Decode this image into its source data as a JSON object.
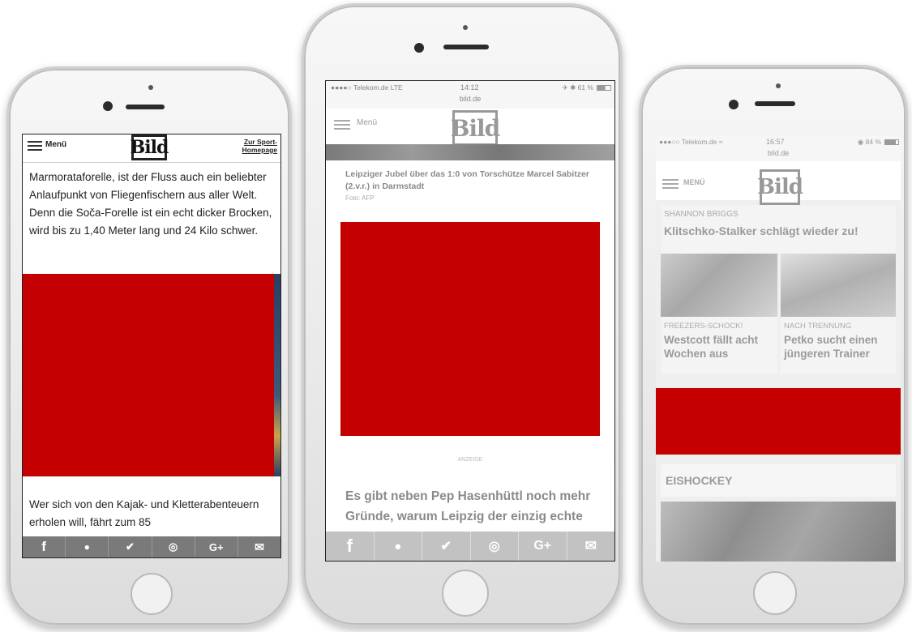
{
  "phone_left": {
    "header": {
      "menu_label": "Menü",
      "logo_text": "Bild",
      "sport_link": "Zur Sport-\nHomepage"
    },
    "article_top": "Marmorataforelle, ist der Fluss auch ein beliebter Anlaufpunkt von Fliegenfischern aus aller Welt. Denn die Soča-Forelle ist ein echt dicker Brocken, wird bis zu 1,40 Meter lang und 24 Kilo schwer.",
    "article_bottom": "Wer sich von den Kajak- und Kletterabenteuern erholen will, fährt zum 85",
    "share": [
      "f",
      "●",
      "✔",
      "◎",
      "G+",
      "✉"
    ]
  },
  "phone_center": {
    "status": {
      "carrier": "●●●●○ Telekom.de  LTE",
      "time": "14:12",
      "battery": "✈ ✱ 61 %",
      "url": "bild.de"
    },
    "header": {
      "menu_label": "Menü",
      "logo_text": "Bild"
    },
    "caption": "Leipziger Jubel über das 1:0 von Torschütze Marcel Sabitzer (2.v.r.) in Darmstadt",
    "credit": "Foto: AFP",
    "ad_label": "ANZEIGE",
    "headline": "Es gibt neben Pep Hasenhüttl noch mehr Gründe, warum Leipzig der einzig echte",
    "share": [
      "f",
      "●",
      "✔",
      "◎",
      "G+",
      "✉"
    ]
  },
  "phone_right": {
    "status": {
      "carrier": "●●●○○ Telekom.de ≈",
      "time": "16:57",
      "battery": "◉ 84 %",
      "url": "bild.de"
    },
    "header": {
      "menu_label": "MENÜ",
      "logo_text": "Bild"
    },
    "story1": {
      "kicker": "SHANNON BRIGGS",
      "title": "Klitschko-Stalker schlägt wieder zu!"
    },
    "story2": {
      "kicker": "FREEZERS-SCHOCK!",
      "title": "Westcott fällt acht Wochen aus"
    },
    "story3": {
      "kicker": "NACH TRENNUNG",
      "title": "Petko sucht einen jüngeren Trainer"
    },
    "section": "EISHOCKEY"
  }
}
